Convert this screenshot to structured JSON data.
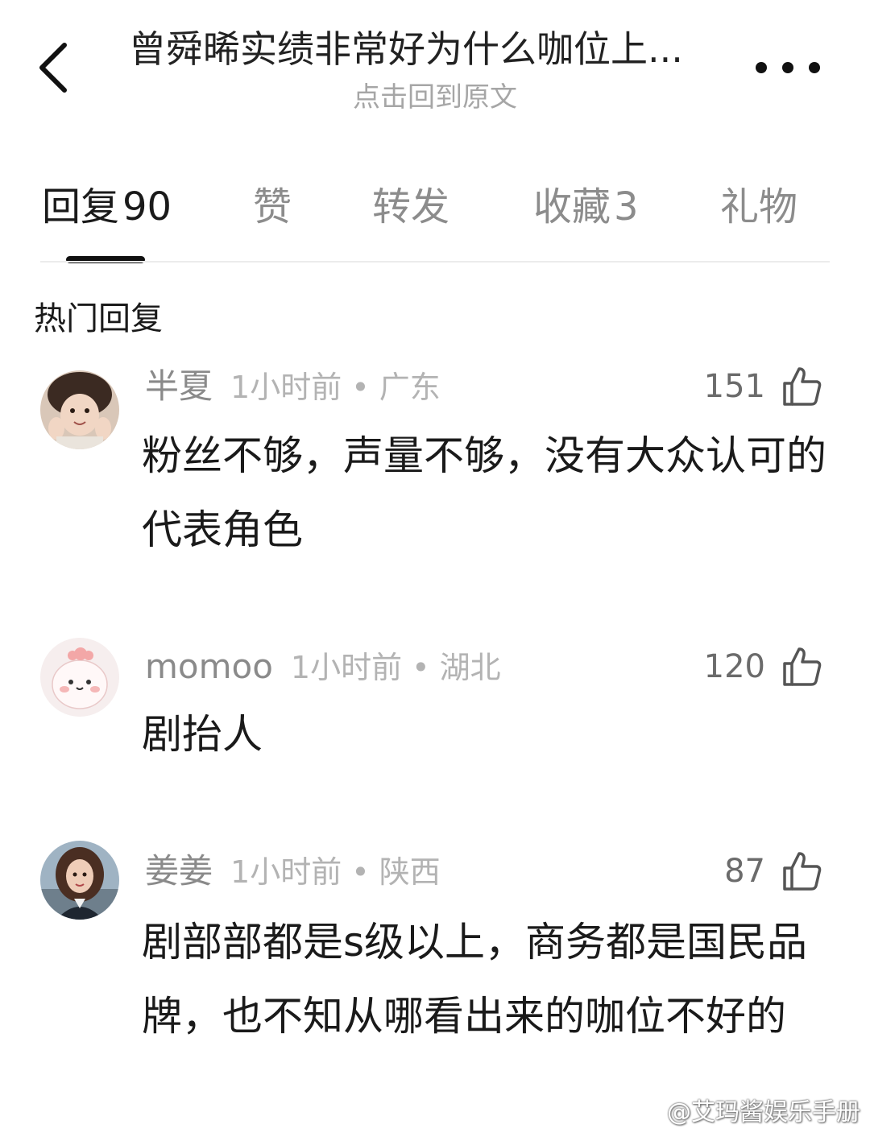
{
  "header": {
    "title": "曾舜晞实绩非常好为什么咖位上...",
    "subtitle": "点击回到原文"
  },
  "tabs": [
    {
      "label": "回复",
      "count": "90",
      "active": true
    },
    {
      "label": "赞",
      "count": "",
      "active": false
    },
    {
      "label": "转发",
      "count": "",
      "active": false
    },
    {
      "label": "收藏",
      "count": "3",
      "active": false
    },
    {
      "label": "礼物",
      "count": "",
      "active": false
    }
  ],
  "section_title": "热门回复",
  "comments": [
    {
      "name": "半夏",
      "time_location": "1小时前 • 广东",
      "likes": "151",
      "content": "粉丝不够，声量不够，没有大众认可的代表角色"
    },
    {
      "name": "momoo",
      "time_location": "1小时前 • 湖北",
      "likes": "120",
      "content": "剧抬人"
    },
    {
      "name": "姜姜",
      "time_location": "1小时前 • 陕西",
      "likes": "87",
      "content": "剧部部都是s级以上，商务都是国民品牌，也不知从哪看出来的咖位不好的"
    }
  ],
  "watermark": "@艾玛酱娱乐手册",
  "colors": {
    "text_primary": "#1a1a1a",
    "text_secondary": "#8a8a8a",
    "text_muted": "#b3b3b3",
    "tab_indicator": "#111111"
  }
}
